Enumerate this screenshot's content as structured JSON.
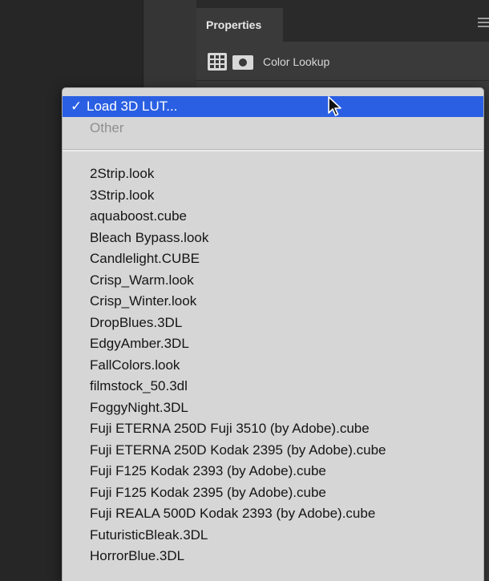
{
  "panel": {
    "tab_label": "Properties",
    "title": "Color Lookup"
  },
  "dropdown": {
    "selected_label": "Load 3D LUT...",
    "selected_check": "✓",
    "disabled_label": "Other",
    "items": [
      "2Strip.look",
      "3Strip.look",
      "aquaboost.cube",
      "Bleach Bypass.look",
      "Candlelight.CUBE",
      "Crisp_Warm.look",
      "Crisp_Winter.look",
      "DropBlues.3DL",
      "EdgyAmber.3DL",
      "FallColors.look",
      "filmstock_50.3dl",
      "FoggyNight.3DL",
      "Fuji ETERNA 250D Fuji 3510 (by Adobe).cube",
      "Fuji ETERNA 250D Kodak 2395 (by Adobe).cube",
      "Fuji F125 Kodak 2393 (by Adobe).cube",
      "Fuji F125 Kodak 2395 (by Adobe).cube",
      "Fuji REALA 500D Kodak 2393 (by Adobe).cube",
      "FuturisticBleak.3DL",
      "HorrorBlue.3DL"
    ]
  },
  "colors": {
    "selection": "#2a5fe3",
    "menu_background": "#d6d6d6",
    "panel_background": "#3a3a3a"
  },
  "icons": {
    "adjustment": "grid-icon",
    "mask": "mask-icon",
    "panel_menu": "hamburger-menu-icon",
    "cursor": "arrow-cursor-icon"
  }
}
